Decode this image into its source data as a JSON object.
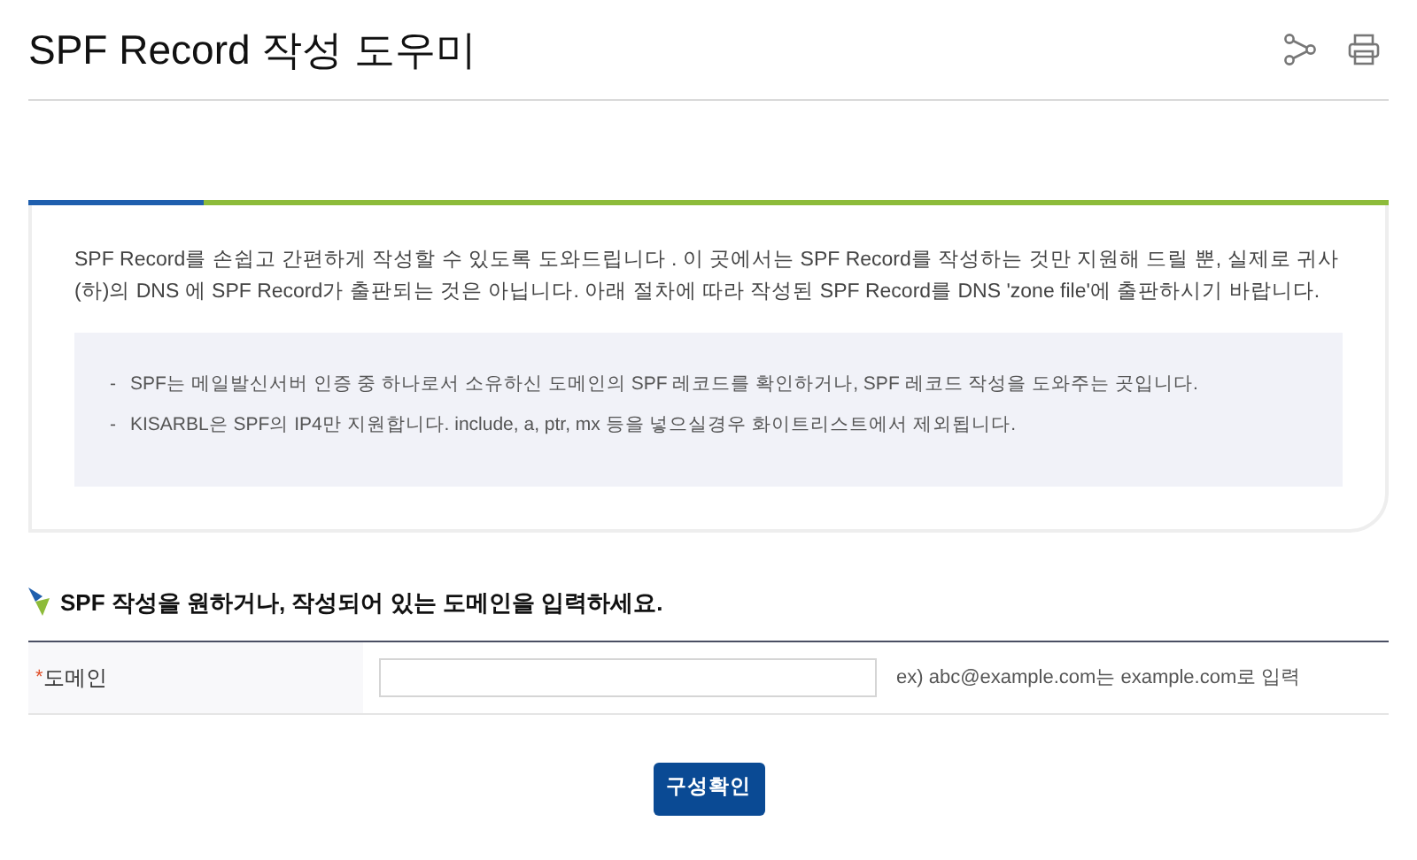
{
  "header": {
    "title": "SPF Record 작성 도우미"
  },
  "intro": {
    "paragraph": "SPF Record를 손쉽고 간편하게 작성할 수 있도록 도와드립니다 . 이 곳에서는 SPF Record를 작성하는 것만 지원해 드릴 뿐, 실제로 귀사(하)의 DNS 에 SPF Record가 출판되는 것은 아닙니다. 아래 절차에 따라 작성된 SPF Record를 DNS 'zone file'에 출판하시기 바랍니다.",
    "notes": [
      {
        "bullet": "-",
        "text": "SPF는 메일발신서버 인증 중 하나로서 소유하신 도메인의 SPF 레코드를 확인하거나, SPF 레코드 작성을 도와주는 곳입니다."
      },
      {
        "bullet": "-",
        "text": "KISARBL은 SPF의 IP4만 지원합니다. include, a, ptr, mx 등을 넣으실경우 화이트리스트에서 제외됩니다."
      }
    ]
  },
  "form": {
    "heading": "SPF 작성을 원하거나, 작성되어 있는 도메인을 입력하세요.",
    "fields": [
      {
        "required_mark": "*",
        "label": "도메인",
        "hint": "ex) abc@example.com는 example.com로 입력"
      }
    ],
    "submit": "구성확인"
  }
}
